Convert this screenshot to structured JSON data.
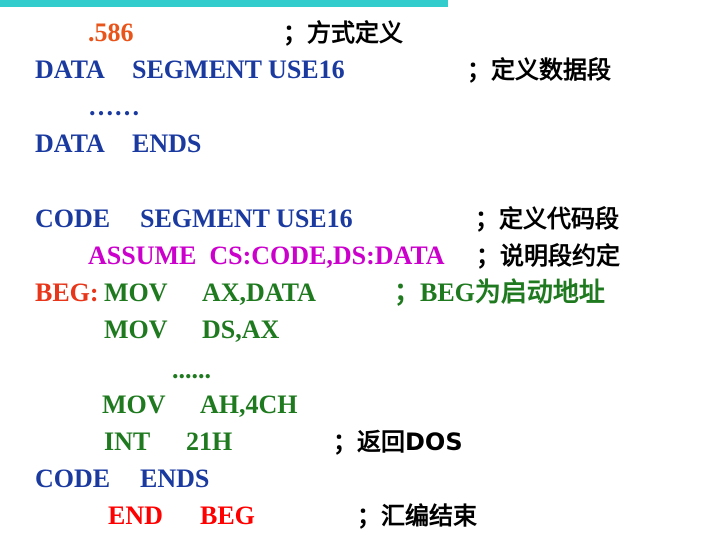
{
  "lines": {
    "l1": {
      "directive": ".586",
      "comment": "；方式定义"
    },
    "l2": {
      "name": "DATA",
      "kw": "SEGMENT USE16",
      "comment": "；定义数据段"
    },
    "l3": {
      "ellipsis": "……"
    },
    "l4": {
      "name": "DATA",
      "kw": "ENDS"
    },
    "l5": {
      "name": "CODE",
      "kw": "SEGMENT USE16",
      "comment": "；定义代码段"
    },
    "l6": {
      "kw": "ASSUME  CS:CODE,DS:DATA",
      "comment": "；说明段约定"
    },
    "l7": {
      "label": "BEG:",
      "op": "MOV",
      "args": "AX,DATA",
      "comment": "；BEG为启动地址"
    },
    "l8": {
      "op": "MOV",
      "args": "DS,AX"
    },
    "l9": {
      "ellipsis": "......"
    },
    "l10": {
      "op": "MOV",
      "args": "AH,4CH"
    },
    "l11": {
      "op": "INT",
      "args": "21H",
      "comment": "；返回DOS"
    },
    "l12": {
      "name": "CODE",
      "kw": "ENDS"
    },
    "l13": {
      "op": "END",
      "args": "BEG",
      "comment": "；汇编结束"
    }
  },
  "colors": {
    "blue": "#1a3aa0",
    "orange": "#e8541a",
    "magenta": "#cc00cc",
    "green": "#1f7a1f",
    "red": "#ff0000",
    "topbar": "#33cccc"
  }
}
